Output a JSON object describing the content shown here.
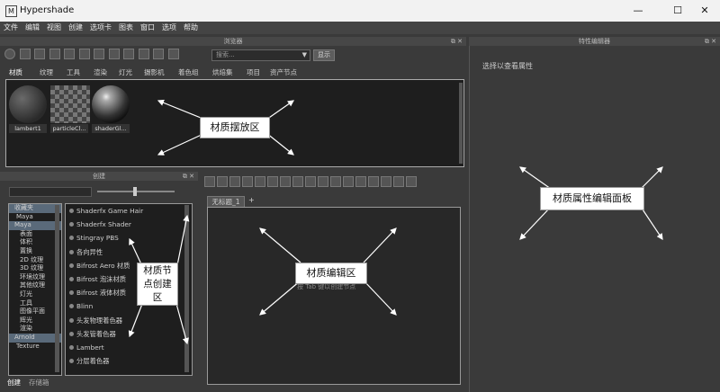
{
  "window": {
    "title": "Hypershade",
    "controls": [
      "—",
      "☐",
      "✕"
    ]
  },
  "menu": [
    "文件",
    "编辑",
    "视图",
    "创建",
    "选项卡",
    "图表",
    "窗口",
    "选项",
    "帮助"
  ],
  "browser": {
    "panel_title": "浏览器",
    "search_placeholder": "搜索...",
    "show_button": "显示",
    "tabs": [
      "材质",
      "纹理",
      "工具",
      "渲染",
      "灯光",
      "摄影机",
      "着色组",
      "烘焙集",
      "项目",
      "资产节点"
    ],
    "swatches": [
      "lambert1",
      "particleCl...",
      "shaderGl..."
    ]
  },
  "create": {
    "panel_title": "创建",
    "tree": [
      "收藏夹",
      "Maya",
      "Maya",
      "表面",
      "体积",
      "置换",
      "2D 纹理",
      "3D 纹理",
      "环境纹理",
      "其他纹理",
      "灯光",
      "工具",
      "图像平面",
      "辉光",
      "渲染",
      "Arnold",
      "Texture"
    ],
    "nodes": [
      "Shaderfx Game Hair",
      "Shaderfx Shader",
      "Stingray PBS",
      "各向异性",
      "Bifrost Aero 材质",
      "Bifrost 泡沫材质",
      "Bifrost 液体材质",
      "Blinn",
      "头发物理着色器",
      "头发管着色器",
      "Lambert",
      "分层着色器"
    ],
    "bottom_tabs": [
      "创建",
      "存储箱"
    ]
  },
  "editor": {
    "tab": "无标题_1",
    "add_tab": "+",
    "hint": "按 Tab 键以创建节点"
  },
  "property": {
    "panel_title": "特性编辑器",
    "hint": "选择以查看属性"
  },
  "annotations": {
    "material_area": "材质摆放区",
    "node_create": "材质节点创建区",
    "node_editor": "材质编辑区",
    "property_panel": "材质属性编辑面板"
  }
}
